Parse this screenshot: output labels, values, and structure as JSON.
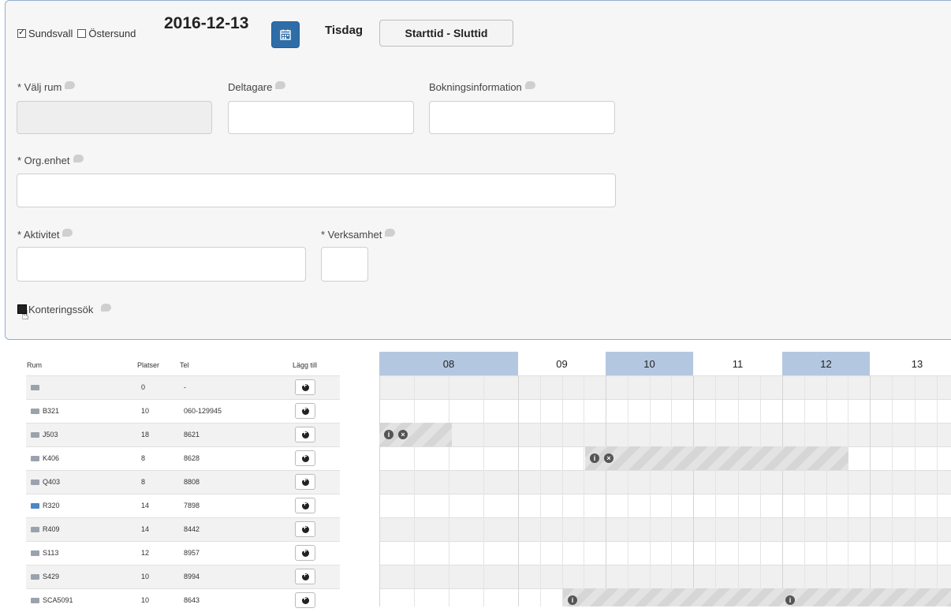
{
  "header": {
    "location1": "Sundsvall",
    "location1_checked": true,
    "location2": "Östersund",
    "location2_checked": false,
    "date": "2016-12-13",
    "weekday": "Tisdag",
    "time_button": "Starttid - Sluttid"
  },
  "form": {
    "room_label": "* Välj rum",
    "participants_label": "Deltagare",
    "booking_info_label": "Bokningsinformation",
    "org_label": "* Org.enhet",
    "activity_label": "* Aktivitet",
    "business_label": "* Verksamhet",
    "account_search_label": "Konteringssök"
  },
  "table": {
    "headers": {
      "rum": "Rum",
      "platser": "Platser",
      "tel": "Tel",
      "add": "Lägg till"
    },
    "rows": [
      {
        "rum": "",
        "platser": "0",
        "tel": "-",
        "icon": "room-icon"
      },
      {
        "rum": "B321",
        "platser": "10",
        "tel": "060-129945",
        "icon": "room-icon"
      },
      {
        "rum": "J503",
        "platser": "18",
        "tel": "8621",
        "icon": "room-icon"
      },
      {
        "rum": "K406",
        "platser": "8",
        "tel": "8628",
        "icon": "room-icon"
      },
      {
        "rum": "Q403",
        "platser": "8",
        "tel": "8808",
        "icon": "room-icon"
      },
      {
        "rum": "R320",
        "platser": "14",
        "tel": "7898",
        "icon": "room-icon-blue"
      },
      {
        "rum": "R409",
        "platser": "14",
        "tel": "8442",
        "icon": "room-icon"
      },
      {
        "rum": "S113",
        "platser": "12",
        "tel": "8957",
        "icon": "room-icon"
      },
      {
        "rum": "S429",
        "platser": "10",
        "tel": "8994",
        "icon": "room-icon"
      },
      {
        "rum": "SCA5091",
        "platser": "10",
        "tel": "8643",
        "icon": "room-icon"
      }
    ]
  },
  "timeline": {
    "hours": [
      "08",
      "09",
      "10",
      "11",
      "12",
      "13"
    ],
    "highlighted_hours": [
      "08",
      "10",
      "12"
    ]
  },
  "colors": {
    "primary": "#2f6da8",
    "hour_highlight": "#b4c7e0"
  }
}
